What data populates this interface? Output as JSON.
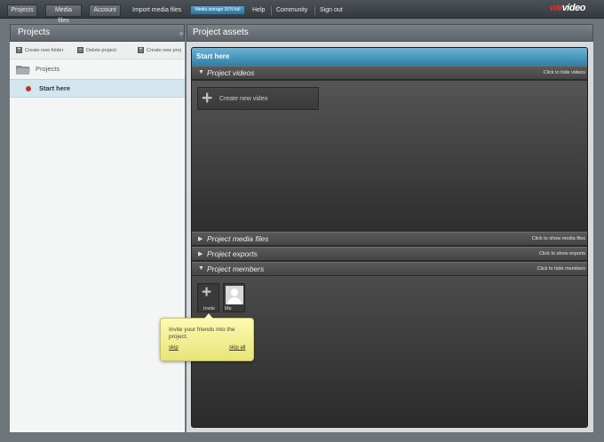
{
  "nav": {
    "tabs": [
      "Projects",
      "Media files",
      "Account"
    ],
    "links": [
      "Import media files",
      "Help",
      "Community",
      "Sign out"
    ],
    "storage_label": "Media storage 31% full",
    "logo_text": "WeVideo"
  },
  "left": {
    "title": "Projects",
    "toolbar": [
      "Create new folder",
      "Delete project",
      "Create new proj"
    ],
    "folder_label": "Projects",
    "items": [
      {
        "label": "Start here"
      }
    ]
  },
  "right": {
    "title": "Project assets",
    "card_title": "Start here",
    "sections": [
      {
        "label": "Project videos",
        "hint": "Click to hide videos",
        "state": "expanded"
      },
      {
        "label": "Project media files",
        "hint": "Click to show media files",
        "state": "collapsed"
      },
      {
        "label": "Project exports",
        "hint": "Click to show exports",
        "state": "collapsed"
      },
      {
        "label": "Project members",
        "hint": "Click to hide members",
        "state": "expanded"
      }
    ],
    "create_video_label": "Create new video",
    "members": [
      {
        "label": "Invite"
      },
      {
        "label": "Me"
      }
    ]
  },
  "tooltip": {
    "message": "Invite your friends into the project.",
    "skip": "skip",
    "skip_all": "skip all"
  },
  "colors": {
    "accent": "#2f7fa8",
    "tooltip_bg": "#fdfab0",
    "dot": "#c0302a"
  }
}
